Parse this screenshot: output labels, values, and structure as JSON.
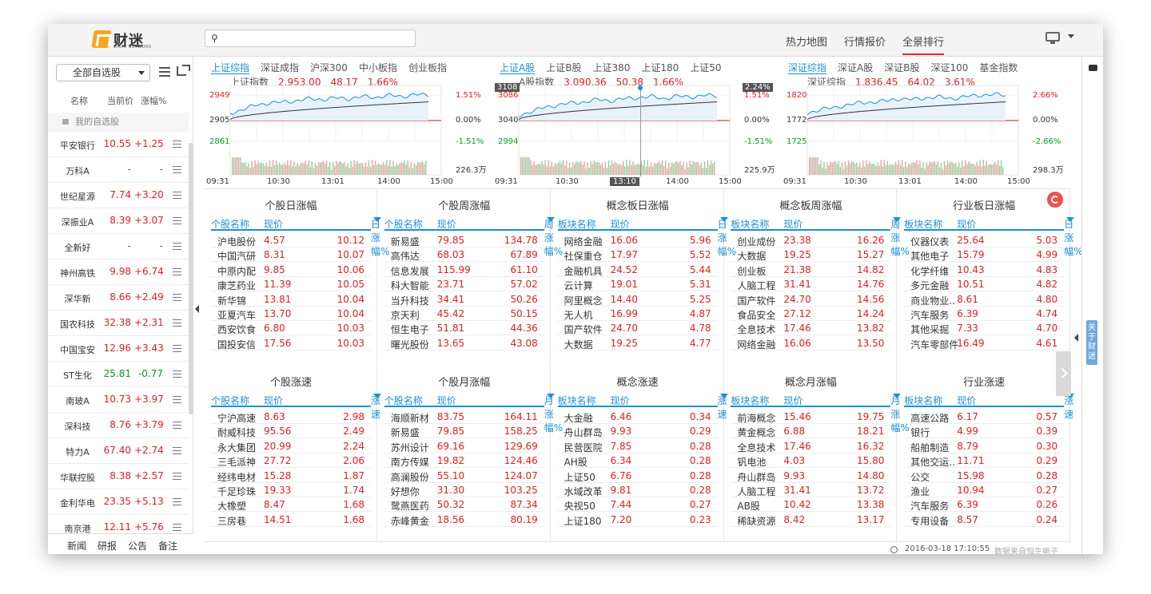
{
  "app": {
    "name": "财迷",
    "sub": "CAIMI NETWORK"
  },
  "header": {
    "search_placeholder": "",
    "nav": [
      "热力地图",
      "行情报价",
      "全景排行"
    ],
    "active_nav": 2
  },
  "sidebar": {
    "select": "全部自选股",
    "cols": [
      "名称",
      "当前价",
      "涨幅%"
    ],
    "group": "我的自选股",
    "stocks": [
      {
        "name": "平安银行",
        "price": "10.55",
        "chg": "+1.25",
        "dir": "up"
      },
      {
        "name": "万科A",
        "price": "-",
        "chg": "-",
        "dir": "none"
      },
      {
        "name": "世纪星源",
        "price": "7.74",
        "chg": "+3.20",
        "dir": "up"
      },
      {
        "name": "深振业A",
        "price": "8.39",
        "chg": "+3.07",
        "dir": "up"
      },
      {
        "name": "全新好",
        "price": "-",
        "chg": "-",
        "dir": "none"
      },
      {
        "name": "神州高铁",
        "price": "9.98",
        "chg": "+6.74",
        "dir": "up"
      },
      {
        "name": "深华新",
        "price": "8.66",
        "chg": "+2.49",
        "dir": "up"
      },
      {
        "name": "国农科技",
        "price": "32.38",
        "chg": "+2.31",
        "dir": "up"
      },
      {
        "name": "中国宝安",
        "price": "12.96",
        "chg": "+3.43",
        "dir": "up"
      },
      {
        "name": "ST生化",
        "price": "25.81",
        "chg": "-0.77",
        "dir": "down"
      },
      {
        "name": "南玻A",
        "price": "10.73",
        "chg": "+3.97",
        "dir": "up"
      },
      {
        "name": "深科技",
        "price": "8.76",
        "chg": "+3.79",
        "dir": "up"
      },
      {
        "name": "特力A",
        "price": "67.40",
        "chg": "+2.74",
        "dir": "up"
      },
      {
        "name": "华联控股",
        "price": "8.38",
        "chg": "+2.57",
        "dir": "up"
      },
      {
        "name": "金利华电",
        "price": "23.35",
        "chg": "+5.13",
        "dir": "up"
      },
      {
        "name": "南京港",
        "price": "12.11",
        "chg": "+5.76",
        "dir": "up"
      }
    ],
    "footer": [
      "新闻",
      "研报",
      "公告",
      "备注"
    ]
  },
  "panels": [
    {
      "tabs": [
        "上证综指",
        "深证成指",
        "沪深300",
        "中小板指",
        "创业板指"
      ],
      "active": 0,
      "index_name": "上证指数",
      "index_val": "2,953.00",
      "index_chg": "48.17",
      "index_pct": "1.66%",
      "y_left": [
        "2949",
        "2905",
        "2861"
      ],
      "y_right": [
        "1.51%",
        "0.00%",
        "-1.51%"
      ],
      "vol": "226.3万",
      "x": [
        "09:31",
        "10:30",
        "13:01",
        "14:00",
        "15:00"
      ]
    },
    {
      "tabs": [
        "上证A股",
        "上证B股",
        "上证380",
        "上证180",
        "上证50"
      ],
      "active": 0,
      "index_name": "A股指数",
      "index_val": "3,090.36",
      "index_chg": "50.38",
      "index_pct": "1.66%",
      "y_left": [
        "3086",
        "3040",
        "2994"
      ],
      "y_right": [
        "1.51%",
        "0.00%",
        "-1.51%"
      ],
      "vol": "225.9万",
      "x": [
        "09:31",
        "10:30",
        "13:10",
        "14:00",
        "15:00"
      ],
      "cross_y": "3108",
      "cross_pct": "2.24%"
    },
    {
      "tabs": [
        "深证综指",
        "深证A股",
        "深证B股",
        "深证100",
        "基金指数"
      ],
      "active": 0,
      "index_name": "深证综指",
      "index_val": "1,836.45",
      "index_chg": "64.02",
      "index_pct": "3.61%",
      "y_left": [
        "1820",
        "1772",
        "1725"
      ],
      "y_right": [
        "2.66%",
        "0.00%",
        "-2.66%"
      ],
      "vol": "298.3万",
      "x": [
        "09:31",
        "10:30",
        "13:01",
        "14:00",
        "15:00"
      ]
    }
  ],
  "boards": [
    {
      "title": "个股日涨幅",
      "cols": [
        "个股名称",
        "现价",
        "日涨幅%"
      ],
      "rows": [
        [
          "沪电股份",
          "4.57",
          "10.12"
        ],
        [
          "中国汽研",
          "8.31",
          "10.07"
        ],
        [
          "中原内配",
          "9.85",
          "10.06"
        ],
        [
          "康芝药业",
          "11.39",
          "10.05"
        ],
        [
          "新华锦",
          "13.81",
          "10.04"
        ],
        [
          "亚夏汽车",
          "13.70",
          "10.04"
        ],
        [
          "西安饮食",
          "6.80",
          "10.03"
        ],
        [
          "国投安信",
          "17.56",
          "10.03"
        ]
      ]
    },
    {
      "title": "个股周涨幅",
      "cols": [
        "个股名称",
        "现价",
        "周涨幅%"
      ],
      "rows": [
        [
          "新易盛",
          "79.85",
          "134.78"
        ],
        [
          "高伟达",
          "68.03",
          "67.89"
        ],
        [
          "信息发展",
          "115.99",
          "61.10"
        ],
        [
          "科大智能",
          "23.71",
          "57.02"
        ],
        [
          "当升科技",
          "34.41",
          "50.26"
        ],
        [
          "京天利",
          "45.42",
          "50.15"
        ],
        [
          "恒生电子",
          "51.81",
          "44.36"
        ],
        [
          "曙光股份",
          "13.65",
          "43.08"
        ]
      ]
    },
    {
      "title": "概念板日涨幅",
      "cols": [
        "板块名称",
        "现价",
        "日涨幅%"
      ],
      "rows": [
        [
          "网络金融",
          "16.06",
          "5.96"
        ],
        [
          "社保重仓",
          "17.97",
          "5.52"
        ],
        [
          "金融机具",
          "24.52",
          "5.44"
        ],
        [
          "云计算",
          "19.01",
          "5.31"
        ],
        [
          "阿里概念",
          "14.40",
          "5.25"
        ],
        [
          "无人机",
          "16.99",
          "4.87"
        ],
        [
          "国产软件",
          "24.70",
          "4.78"
        ],
        [
          "大数据",
          "19.25",
          "4.77"
        ]
      ]
    },
    {
      "title": "概念板周涨幅",
      "cols": [
        "板块名称",
        "现价",
        "周涨幅%"
      ],
      "rows": [
        [
          "创业成份",
          "23.38",
          "16.26"
        ],
        [
          "大数据",
          "19.25",
          "15.27"
        ],
        [
          "创业板",
          "21.38",
          "14.82"
        ],
        [
          "人脑工程",
          "31.41",
          "14.76"
        ],
        [
          "国产软件",
          "24.70",
          "14.56"
        ],
        [
          "食品安全",
          "27.12",
          "14.24"
        ],
        [
          "全息技术",
          "17.46",
          "13.82"
        ],
        [
          "网络金融",
          "16.06",
          "13.50"
        ]
      ]
    },
    {
      "title": "行业板日涨幅",
      "cols": [
        "板块名称",
        "现价",
        "日涨幅%"
      ],
      "rows": [
        [
          "仪器仪表",
          "25.64",
          "5.03"
        ],
        [
          "其他电子",
          "15.79",
          "4.99"
        ],
        [
          "化学纤维",
          "10.43",
          "4.83"
        ],
        [
          "多元金融",
          "10.51",
          "4.82"
        ],
        [
          "商业物业..",
          "8.61",
          "4.80"
        ],
        [
          "汽车服务",
          "6.39",
          "4.74"
        ],
        [
          "其他采掘",
          "7.33",
          "4.70"
        ],
        [
          "汽车零部件",
          "16.49",
          "4.61"
        ]
      ]
    },
    {
      "title": "个股涨速",
      "cols": [
        "个股名称",
        "现价",
        "涨速"
      ],
      "rows": [
        [
          "宁沪高速",
          "8.63",
          "2.98"
        ],
        [
          "耐威科技",
          "95.56",
          "2.49"
        ],
        [
          "永大集团",
          "20.99",
          "2.24"
        ],
        [
          "三毛派神",
          "27.72",
          "2.06"
        ],
        [
          "经纬电材",
          "15.28",
          "1.87"
        ],
        [
          "千足珍珠",
          "19.33",
          "1.74"
        ],
        [
          "大橡塑",
          "8.47",
          "1.68"
        ],
        [
          "三房巷",
          "14.51",
          "1.68"
        ]
      ]
    },
    {
      "title": "个股月涨幅",
      "cols": [
        "个股名称",
        "现价",
        "月涨幅%"
      ],
      "rows": [
        [
          "海顺新材",
          "83.75",
          "164.11"
        ],
        [
          "新易盛",
          "79.85",
          "158.25"
        ],
        [
          "苏州设计",
          "69.16",
          "129.69"
        ],
        [
          "南方传媒",
          "19.82",
          "124.46"
        ],
        [
          "高澜股份",
          "55.10",
          "124.07"
        ],
        [
          "好想你",
          "31.30",
          "103.25"
        ],
        [
          "鹭燕医药",
          "50.32",
          "87.34"
        ],
        [
          "赤峰黄金",
          "18.56",
          "80.19"
        ]
      ]
    },
    {
      "title": "概念涨速",
      "cols": [
        "板块名称",
        "现价",
        "涨速"
      ],
      "rows": [
        [
          "大金融",
          "6.46",
          "0.34"
        ],
        [
          "舟山群岛",
          "9.93",
          "0.29"
        ],
        [
          "民营医院",
          "7.85",
          "0.28"
        ],
        [
          "AH股",
          "6.34",
          "0.28"
        ],
        [
          "上证50",
          "6.76",
          "0.28"
        ],
        [
          "水域改革",
          "9.81",
          "0.28"
        ],
        [
          "央视50",
          "7.44",
          "0.27"
        ],
        [
          "上证180",
          "7.20",
          "0.23"
        ]
      ]
    },
    {
      "title": "概念月涨幅",
      "cols": [
        "板块名称",
        "现价",
        "月涨幅%"
      ],
      "rows": [
        [
          "前海概念",
          "15.46",
          "19.75"
        ],
        [
          "黄金概念",
          "6.88",
          "18.21"
        ],
        [
          "全息技术",
          "17.46",
          "16.32"
        ],
        [
          "钒电池",
          "4.03",
          "15.80"
        ],
        [
          "舟山群岛",
          "9.93",
          "14.80"
        ],
        [
          "人脑工程",
          "31.41",
          "13.72"
        ],
        [
          "AB股",
          "10.42",
          "13.38"
        ],
        [
          "稀缺资源",
          "8.42",
          "13.17"
        ]
      ]
    },
    {
      "title": "行业涨速",
      "cols": [
        "板块名称",
        "现价",
        "涨速"
      ],
      "rows": [
        [
          "高速公路",
          "6.17",
          "0.57"
        ],
        [
          "银行",
          "4.99",
          "0.39"
        ],
        [
          "船舶制造",
          "8.79",
          "0.30"
        ],
        [
          "其他交运..",
          "11.71",
          "0.29"
        ],
        [
          "公交",
          "15.98",
          "0.28"
        ],
        [
          "渔业",
          "10.94",
          "0.27"
        ],
        [
          "汽车服务",
          "6.39",
          "0.26"
        ],
        [
          "专用设备",
          "8.57",
          "0.24"
        ]
      ]
    }
  ],
  "footer": {
    "time": "2016-03-18 17:10:55",
    "source": "数据来自恒生电子"
  },
  "right": {
    "about": "关于财迷"
  },
  "colors": {
    "up": "#e02020",
    "down": "#0a9a20",
    "accent": "#1a8fd8"
  }
}
